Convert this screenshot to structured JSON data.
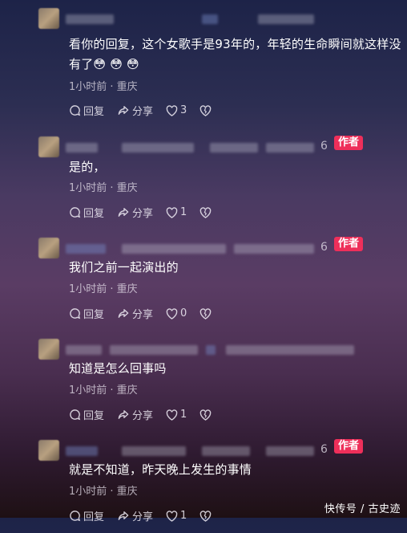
{
  "comments": [
    {
      "text": "看你的回复，这个女歌手是93年的，年轻的生命瞬间就这样没有了😳 😳 😳",
      "meta": "1小时前 · 重庆",
      "reply": "回复",
      "share": "分享",
      "likes": "3",
      "digit": "",
      "badge": ""
    },
    {
      "text": "是的，",
      "meta": "1小时前 · 重庆",
      "reply": "回复",
      "share": "分享",
      "likes": "1",
      "digit": "6",
      "badge": "作者"
    },
    {
      "text": "我们之前一起演出的",
      "meta": "1小时前 · 重庆",
      "reply": "回复",
      "share": "分享",
      "likes": "0",
      "digit": "6",
      "badge": "作者"
    },
    {
      "text": "知道是怎么回事吗",
      "meta": "1小时前 · 重庆",
      "reply": "回复",
      "share": "分享",
      "likes": "1",
      "digit": "",
      "badge": ""
    },
    {
      "text": "就是不知道，昨天晚上发生的事情",
      "meta": "1小时前 · 重庆",
      "reply": "回复",
      "share": "分享",
      "likes": "1",
      "digit": "6",
      "badge": "作者"
    }
  ],
  "watermark": "快传号 / 古史迹",
  "colors": {
    "badge": "#ee2f5a"
  }
}
